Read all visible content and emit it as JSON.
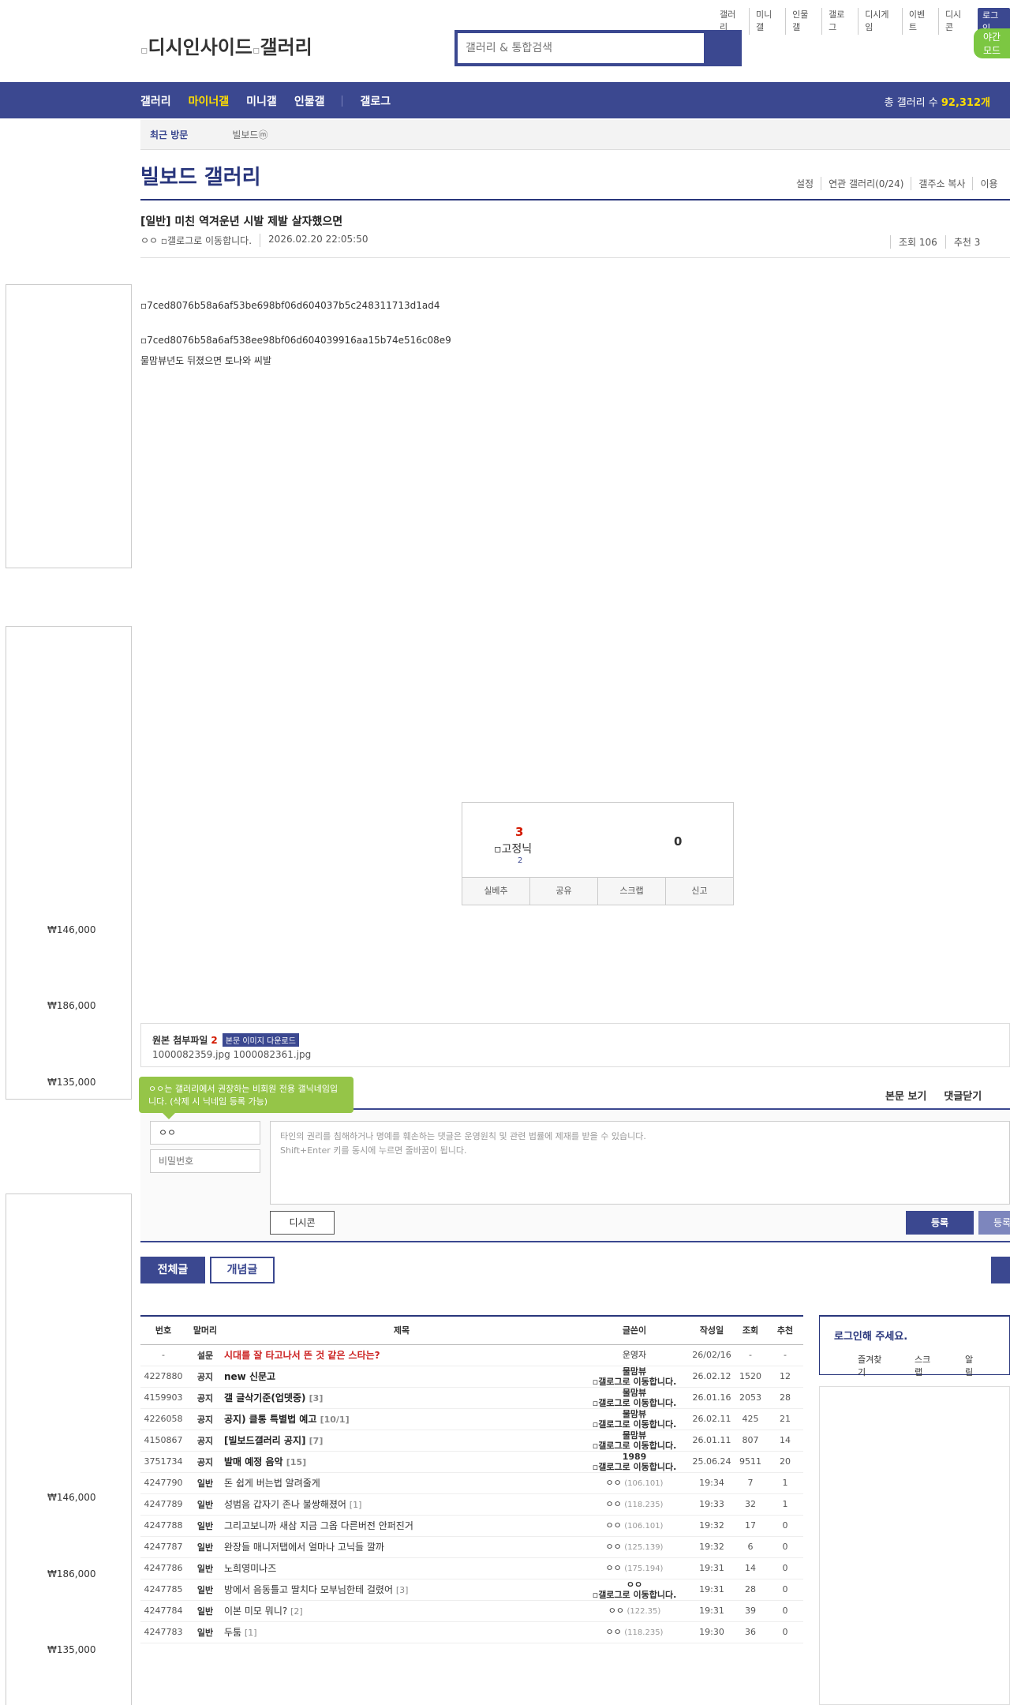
{
  "util_nav": [
    "갤러리",
    "미니갤",
    "인물갤",
    "갤로그",
    "디시게임",
    "이벤트",
    "디시콘"
  ],
  "login_label": "로그인",
  "night_mode": "야간 모드",
  "logo": {
    "brand": "디시인사이드",
    "gallery": "갤러리"
  },
  "search": {
    "placeholder": "갤러리 & 통합검색"
  },
  "gnb": {
    "items": [
      "갤러리",
      "마이너갤",
      "미니갤",
      "인물갤",
      "갤로그"
    ],
    "active": "마이너갤",
    "count_label": "총 갤러리 수",
    "count_value": "92,312개"
  },
  "recent": {
    "title": "최근 방문",
    "item": "빌보드ⓜ"
  },
  "gallery": {
    "title": "빌보드 갤러리",
    "tools": [
      "설정",
      "연관 갤러리(0/24)",
      "갤주소 복사",
      "이용"
    ]
  },
  "post": {
    "title": "[일반] 미친 역겨운년 시발 제발 살자했으면",
    "author": "ㅇㅇ",
    "author_icon_alt": "갤로그로 이동합니다.",
    "date": "2026.02.20 22:05:50",
    "views": "조회 106",
    "recommend": "추천 3",
    "images": [
      "7ced8076b58a6af53be698bf06d604037b5c248311713d1ad4",
      "7ced8076b58a6af538ee98bf06d604039916aa15b74e516c08e9"
    ],
    "text": "물맘뷰년도 뒤졌으면 토나와 씨발"
  },
  "ads": {
    "prices_top": [
      "₩146,000",
      "₩186,000",
      "₩135,000"
    ],
    "prices_bottom": [
      "₩146,000",
      "₩186,000",
      "₩135,000"
    ]
  },
  "recommend_box": {
    "up": "3",
    "fixed_alt": "고정닉",
    "fixed_count": "2",
    "down": "0",
    "buttons": [
      "실베추",
      "공유",
      "스크랩",
      "신고"
    ]
  },
  "attach": {
    "label": "원본 첨부파일",
    "count": "2",
    "download": "본문 이미지 다운로드",
    "files": "1000082359.jpg  1000082361.jpg"
  },
  "comment": {
    "tip": "ㅇㅇ는 갤러리에서 권장하는 비회원 전용 갤닉네임입니다. (삭제 시 닉네임 등록 가능)",
    "tools": [
      "본문 보기",
      "댓글닫기"
    ],
    "nick": "ㅇㅇ",
    "pw_placeholder": "비밀번호",
    "notice1": "타인의 권리를 침해하거나 명예를 훼손하는 댓글은 운영원칙 및 관련 법률에 제재를 받을 수 있습니다.",
    "notice2": "Shift+Enter 키를 동시에 누르면 줄바꿈이 됩니다.",
    "dccon": "디시콘",
    "submit": "등록",
    "submit2": "등록"
  },
  "tabs": {
    "all": "전체글",
    "concept": "개념글"
  },
  "list": {
    "headers": [
      "번호",
      "말머리",
      "제목",
      "글쓴이",
      "작성일",
      "조회",
      "추천"
    ],
    "rows": [
      {
        "no": "-",
        "head": "설문",
        "title": "시대를 잘 타고나서 뜬 것 같은 스타는?",
        "rc": "",
        "writer": "운영자",
        "ip": "",
        "icon": false,
        "date": "26/02/16",
        "views": "-",
        "rec": "-",
        "type": "hl"
      },
      {
        "no": "4227880",
        "head": "공지",
        "title": "new 신문고",
        "rc": "",
        "writer": "물맘뷰",
        "ip": "",
        "icon": true,
        "date": "26.02.12",
        "views": "1520",
        "rec": "12",
        "type": "nt"
      },
      {
        "no": "4159903",
        "head": "공지",
        "title": "갤 글삭기준(업뎃중)",
        "rc": "[3]",
        "writer": "물맘뷰",
        "ip": "",
        "icon": true,
        "date": "26.01.16",
        "views": "2053",
        "rec": "28",
        "type": "nt"
      },
      {
        "no": "4226058",
        "head": "공지",
        "title": "공지) 클통 특별법 예고",
        "rc": "[10/1]",
        "writer": "물맘뷰",
        "ip": "",
        "icon": true,
        "date": "26.02.11",
        "views": "425",
        "rec": "21",
        "type": "nt"
      },
      {
        "no": "4150867",
        "head": "공지",
        "title": "[빌보드갤러리 공지]",
        "rc": "[7]",
        "writer": "물맘뷰",
        "ip": "",
        "icon": true,
        "date": "26.01.11",
        "views": "807",
        "rec": "14",
        "type": "nt"
      },
      {
        "no": "3751734",
        "head": "공지",
        "title": "발매 예정 음악",
        "rc": "[15]",
        "writer": "1989",
        "ip": "",
        "icon": true,
        "date": "25.06.24",
        "views": "9511",
        "rec": "20",
        "type": "nt"
      },
      {
        "no": "4247790",
        "head": "일반",
        "title": "돈 쉽게 버는법 알려줄게",
        "rc": "",
        "writer": "ㅇㅇ",
        "ip": "(106.101)",
        "icon": false,
        "date": "19:34",
        "views": "7",
        "rec": "1",
        "type": ""
      },
      {
        "no": "4247789",
        "head": "일반",
        "title": "성범음 갑자기 존나 불쌍해졌어",
        "rc": "[1]",
        "writer": "ㅇㅇ",
        "ip": "(118.235)",
        "icon": false,
        "date": "19:33",
        "views": "32",
        "rec": "1",
        "type": ""
      },
      {
        "no": "4247788",
        "head": "일반",
        "title": "그리고보니까 새삼 지금 그옵 다른버전 안퍼진거",
        "rc": "",
        "writer": "ㅇㅇ",
        "ip": "(106.101)",
        "icon": false,
        "date": "19:32",
        "views": "17",
        "rec": "0",
        "type": ""
      },
      {
        "no": "4247787",
        "head": "일반",
        "title": "완장들 매니저탭에서 얼마나 고닉들 깔까",
        "rc": "",
        "writer": "ㅇㅇ",
        "ip": "(125.139)",
        "icon": false,
        "date": "19:32",
        "views": "6",
        "rec": "0",
        "type": ""
      },
      {
        "no": "4247786",
        "head": "일반",
        "title": "노희영미나즈",
        "rc": "",
        "writer": "ㅇㅇ",
        "ip": "(175.194)",
        "icon": false,
        "date": "19:31",
        "views": "14",
        "rec": "0",
        "type": ""
      },
      {
        "no": "4247785",
        "head": "일반",
        "title": "방에서 음동틀고 딸치다 모부님한테 걸렸어",
        "rc": "[3]",
        "writer": "ㅇㅇ",
        "ip": "",
        "icon": true,
        "date": "19:31",
        "views": "28",
        "rec": "0",
        "type": ""
      },
      {
        "no": "4247784",
        "head": "일반",
        "title": "이본 미모 뭐니?",
        "rc": "[2]",
        "writer": "ㅇㅇ",
        "ip": "(122.35)",
        "icon": false,
        "date": "19:31",
        "views": "39",
        "rec": "0",
        "type": ""
      },
      {
        "no": "4247783",
        "head": "일반",
        "title": "두툼",
        "rc": "[1]",
        "writer": "ㅇㅇ",
        "ip": "(118.235)",
        "icon": false,
        "date": "19:30",
        "views": "36",
        "rec": "0",
        "type": ""
      }
    ],
    "icon_alt": "갤로그로 이동합니다."
  },
  "login_box": {
    "title": "로그인해 주세요.",
    "menu": [
      "즐겨찾기",
      "스크랩",
      "알림"
    ]
  }
}
